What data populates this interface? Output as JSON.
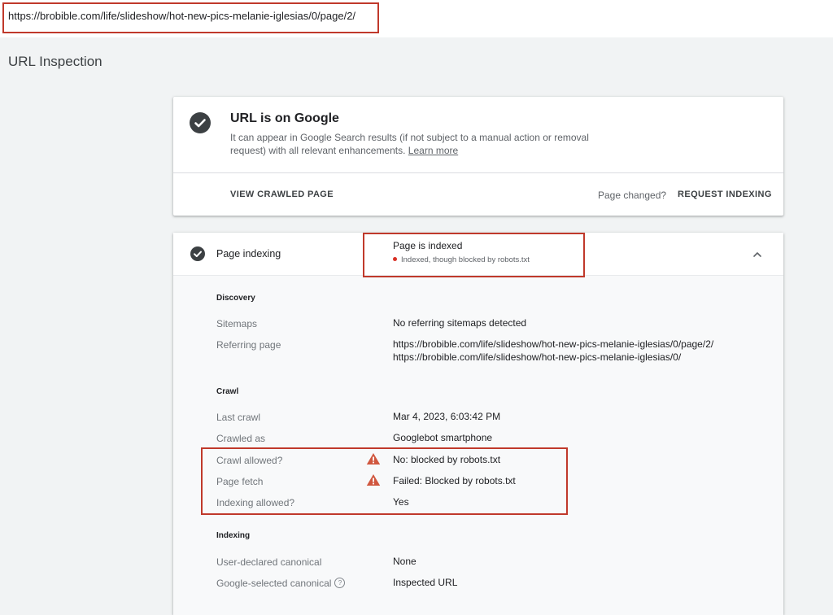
{
  "address_bar": {
    "url": "https://brobible.com/life/slideshow/hot-new-pics-melanie-iglesias/0/page/2/"
  },
  "page": {
    "title": "URL Inspection"
  },
  "status_card": {
    "title": "URL is on Google",
    "description": "It can appear in Google Search results (if not subject to a manual action or removal request) with all relevant enhancements.",
    "learn_more": "Learn more",
    "view_crawled": "VIEW CRAWLED PAGE",
    "page_changed": "Page changed?",
    "request_indexing": "REQUEST INDEXING"
  },
  "indexing_card": {
    "label": "Page indexing",
    "status": "Page is indexed",
    "substatus": "Indexed, though blocked by robots.txt",
    "sections": {
      "discovery": {
        "heading": "Discovery",
        "sitemaps_label": "Sitemaps",
        "sitemaps_value": "No referring sitemaps detected",
        "referring_label": "Referring page",
        "referring_value_1": "https://brobible.com/life/slideshow/hot-new-pics-melanie-iglesias/0/page/2/",
        "referring_value_2": "https://brobible.com/life/slideshow/hot-new-pics-melanie-iglesias/0/"
      },
      "crawl": {
        "heading": "Crawl",
        "last_crawl_label": "Last crawl",
        "last_crawl_value": "Mar 4, 2023, 6:03:42 PM",
        "crawled_as_label": "Crawled as",
        "crawled_as_value": "Googlebot smartphone",
        "crawl_allowed_label": "Crawl allowed?",
        "crawl_allowed_value": "No: blocked by robots.txt",
        "page_fetch_label": "Page fetch",
        "page_fetch_value": "Failed: Blocked by robots.txt",
        "indexing_allowed_label": "Indexing allowed?",
        "indexing_allowed_value": "Yes"
      },
      "indexing": {
        "heading": "Indexing",
        "user_canonical_label": "User-declared canonical",
        "user_canonical_value": "None",
        "google_canonical_label": "Google-selected canonical",
        "google_canonical_value": "Inspected URL",
        "help_glyph": "?"
      }
    }
  },
  "colors": {
    "highlight": "#c0392b",
    "warning": "#d0573f",
    "icon_dark": "#3c4043"
  }
}
